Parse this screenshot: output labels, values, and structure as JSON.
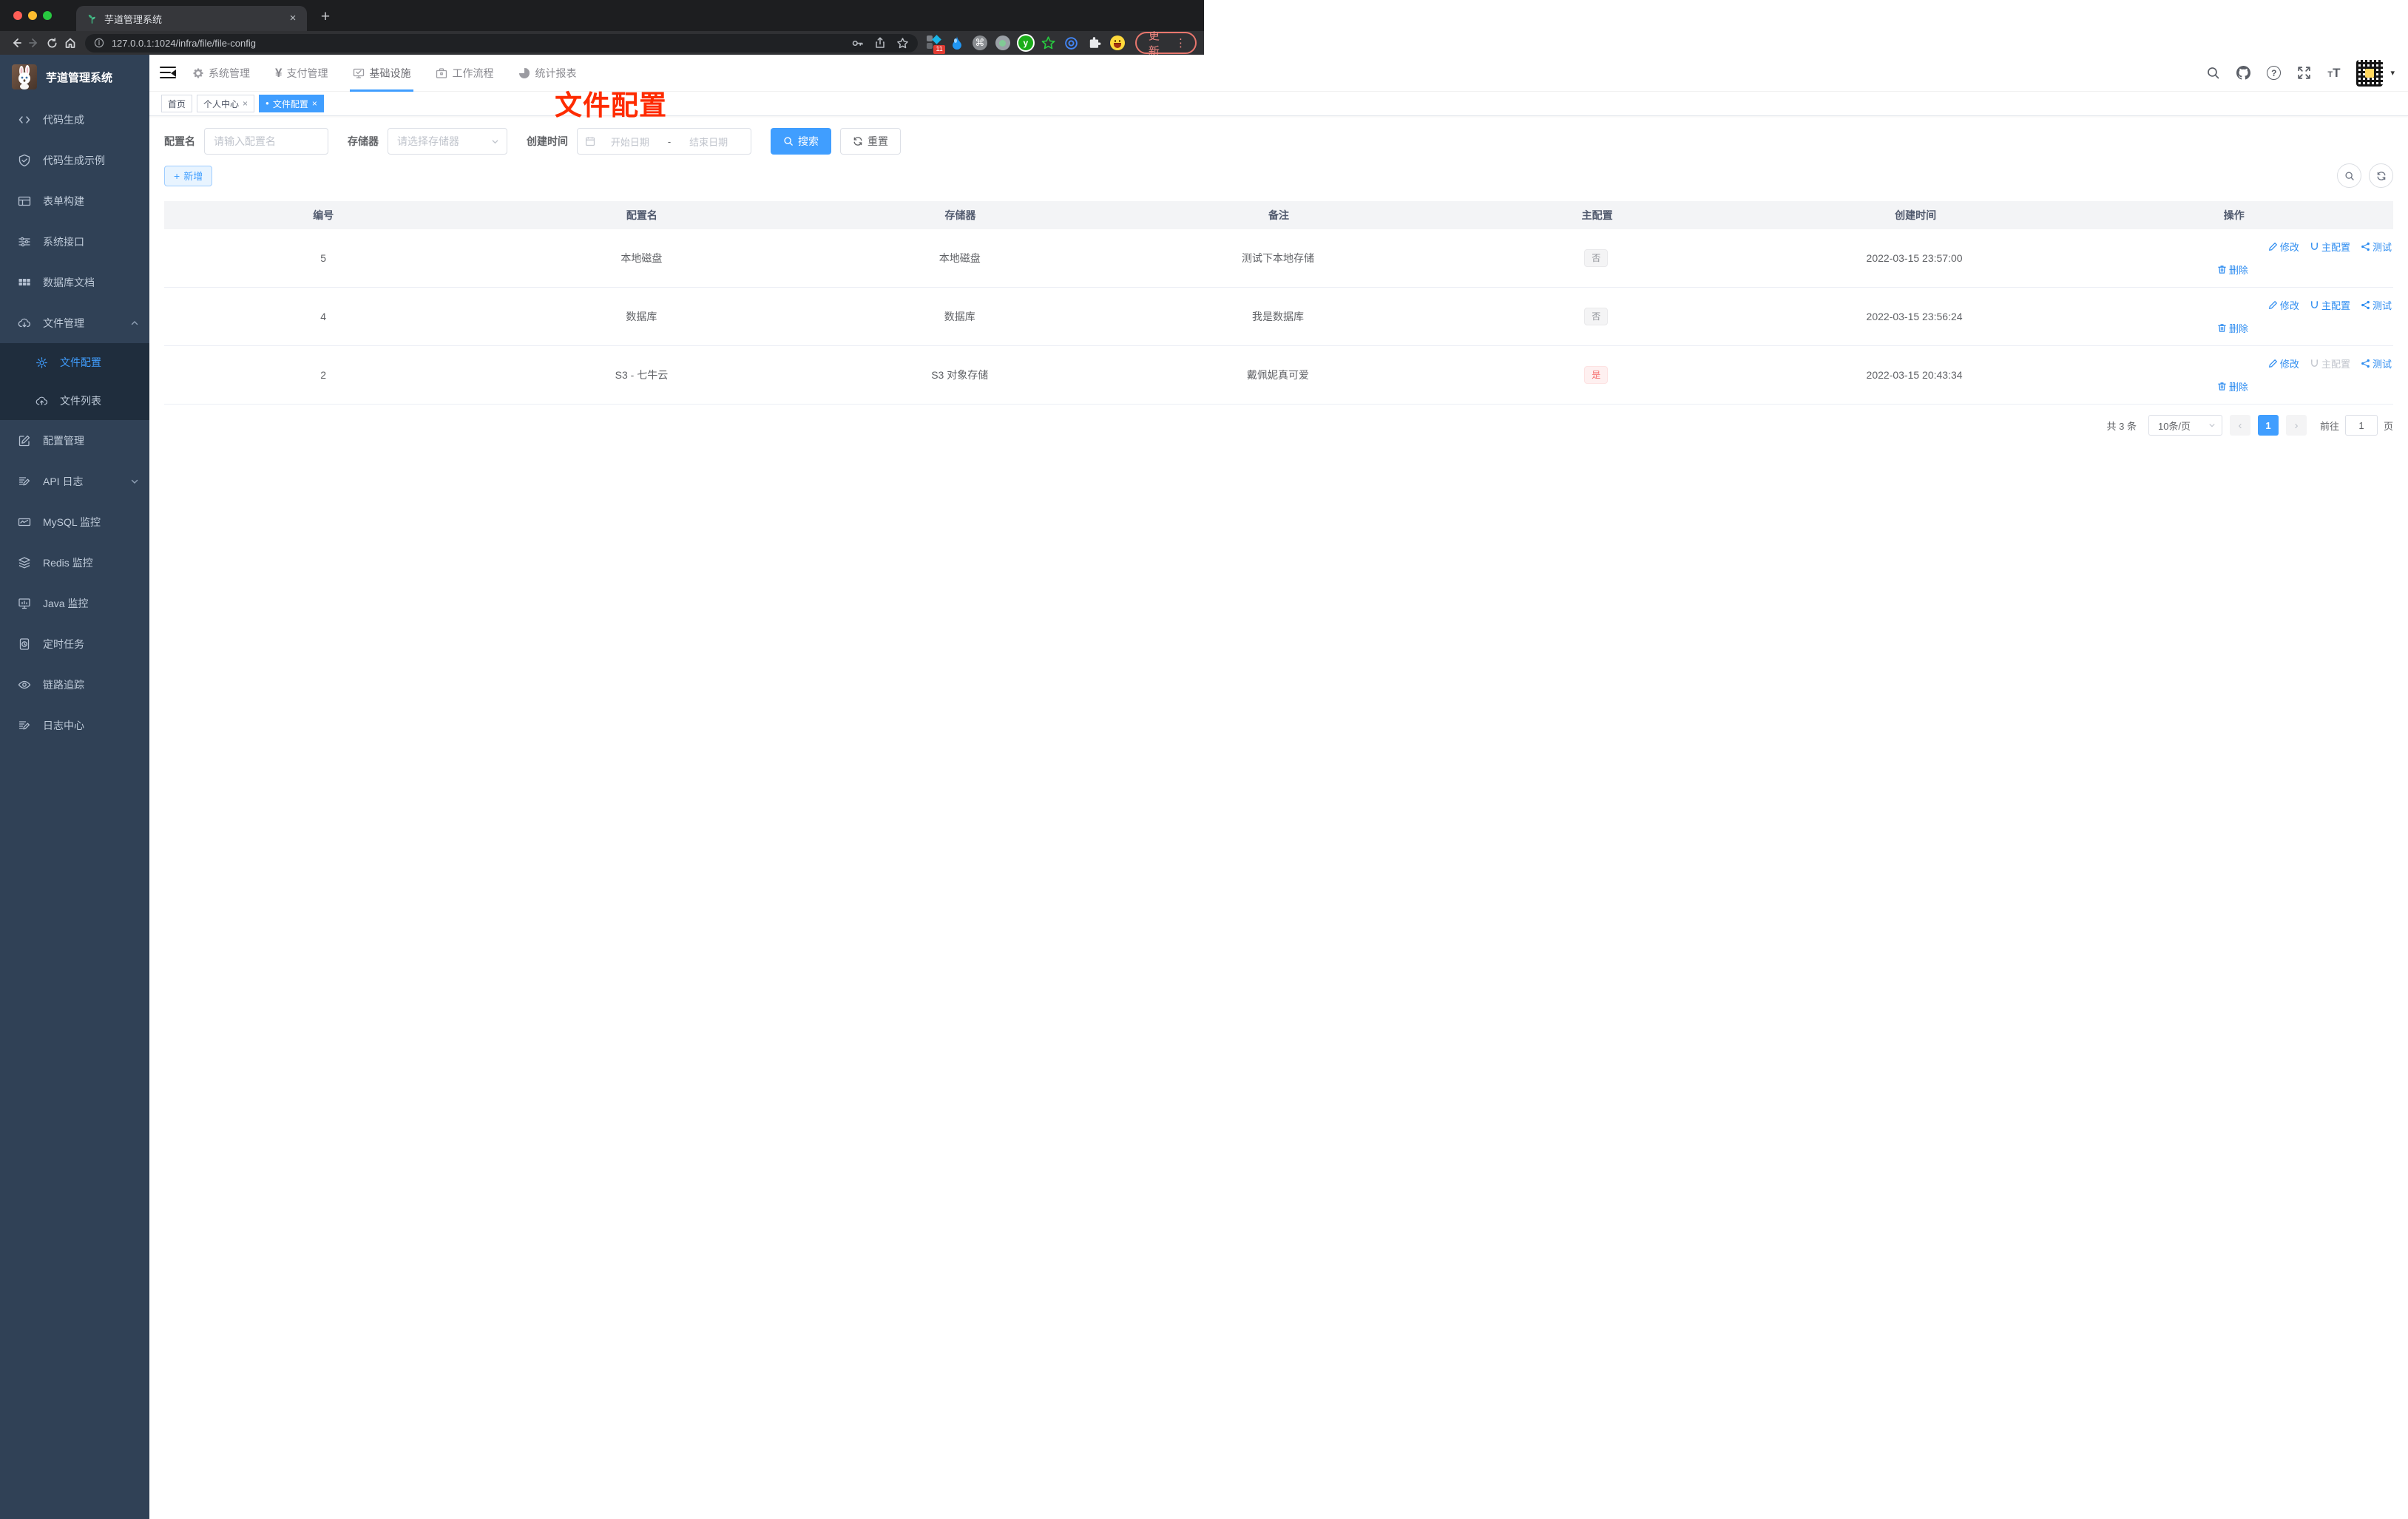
{
  "colors": {
    "accent": "#409eff",
    "danger": "#f56c6c",
    "annotation_red": "#fe2b00",
    "sidebar_bg": "#304156",
    "submenu_bg": "#1f2d3d"
  },
  "glyphs": {
    "yen": "¥",
    "question": "?",
    "letter_t": "T",
    "close": "×",
    "plus": "+",
    "prev": "‹",
    "next": "›",
    "caret_down": "▾",
    "dot": "●",
    "more": "⋮",
    "command": "⌘",
    "ext_y": "y"
  },
  "browser": {
    "tab_title": "芋道管理系统",
    "url": "127.0.0.1:1024/infra/file/file-config",
    "update_label": "更新",
    "ext_badge": "11"
  },
  "sidebar": {
    "app_title": "芋道管理系统",
    "items": [
      {
        "label": "代码生成"
      },
      {
        "label": "代码生成示例"
      },
      {
        "label": "表单构建"
      },
      {
        "label": "系统接口"
      },
      {
        "label": "数据库文档"
      },
      {
        "label": "文件管理"
      },
      {
        "label": "文件配置"
      },
      {
        "label": "文件列表"
      },
      {
        "label": "配置管理"
      },
      {
        "label": "API 日志"
      },
      {
        "label": "MySQL 监控"
      },
      {
        "label": "Redis 监控"
      },
      {
        "label": "Java 监控"
      },
      {
        "label": "定时任务"
      },
      {
        "label": "链路追踪"
      },
      {
        "label": "日志中心"
      }
    ]
  },
  "topnav": {
    "items": [
      {
        "label": "系统管理"
      },
      {
        "label": "支付管理"
      },
      {
        "label": "基础设施"
      },
      {
        "label": "工作流程"
      },
      {
        "label": "统计报表"
      }
    ]
  },
  "tags": [
    {
      "label": "首页"
    },
    {
      "label": "个人中心"
    },
    {
      "label": "文件配置"
    }
  ],
  "annotation": {
    "text": "文件配置"
  },
  "filter": {
    "name_label": "配置名",
    "name_placeholder": "请输入配置名",
    "storage_label": "存储器",
    "storage_placeholder": "请选择存储器",
    "time_label": "创建时间",
    "start_placeholder": "开始日期",
    "separator": "-",
    "end_placeholder": "结束日期",
    "search_label": "搜索",
    "reset_label": "重置"
  },
  "toolbar": {
    "add_label": "新增"
  },
  "table": {
    "headers": [
      "编号",
      "配置名",
      "存储器",
      "备注",
      "主配置",
      "创建时间",
      "操作"
    ],
    "actions": {
      "edit": "修改",
      "master": "主配置",
      "test": "测试",
      "del": "删除"
    },
    "rows": [
      {
        "id": "5",
        "name": "本地磁盘",
        "storage": "本地磁盘",
        "remark": "测试下本地存储",
        "master": "否",
        "time": "2022-03-15 23:57:00"
      },
      {
        "id": "4",
        "name": "数据库",
        "storage": "数据库",
        "remark": "我是数据库",
        "master": "否",
        "time": "2022-03-15 23:56:24"
      },
      {
        "id": "2",
        "name": "S3 - 七牛云",
        "storage": "S3 对象存储",
        "remark": "戴佩妮真可爱",
        "master": "是",
        "time": "2022-03-15 20:43:34"
      }
    ]
  },
  "pagination": {
    "total": "共 3 条",
    "page_size": "10条/页",
    "current_page": "1",
    "goto_label": "前往",
    "goto_value": "1",
    "page_unit": "页"
  }
}
